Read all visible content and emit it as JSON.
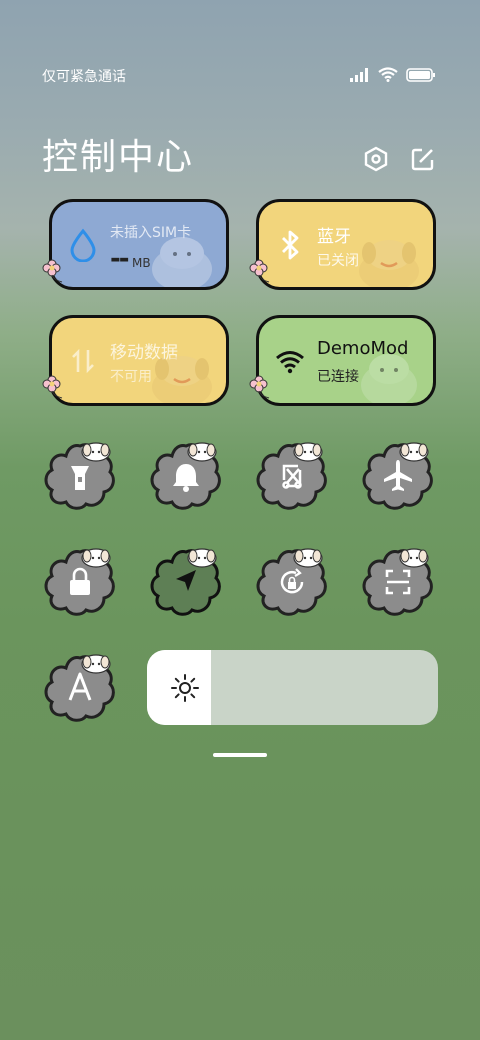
{
  "status_bar": {
    "carrier": "仅可紧急通话"
  },
  "header": {
    "title": "控制中心"
  },
  "cards": {
    "sim": {
      "name": "未插入SIM卡",
      "value": "--",
      "unit": "MB",
      "color": "#8ea9d3"
    },
    "bluetooth": {
      "name": "蓝牙",
      "status": "已关闭",
      "color": "#f2d57c"
    },
    "mobile_data": {
      "name": "移动数据",
      "status": "不可用",
      "color": "#f2d57c"
    },
    "wifi": {
      "name": "DemoMod",
      "status": "已连接",
      "color": "#a8d289"
    }
  },
  "toggles": [
    {
      "name": "flashlight-icon",
      "active": false
    },
    {
      "name": "bell-icon",
      "active": false
    },
    {
      "name": "screenshot-icon",
      "active": false
    },
    {
      "name": "airplane-icon",
      "active": false
    },
    {
      "name": "lock-icon",
      "active": false
    },
    {
      "name": "location-icon",
      "active": true
    },
    {
      "name": "rotation-lock-icon",
      "active": false
    },
    {
      "name": "scan-icon",
      "active": false
    },
    {
      "name": "font-icon",
      "active": false
    }
  ],
  "brightness": {
    "level": 0.22
  }
}
